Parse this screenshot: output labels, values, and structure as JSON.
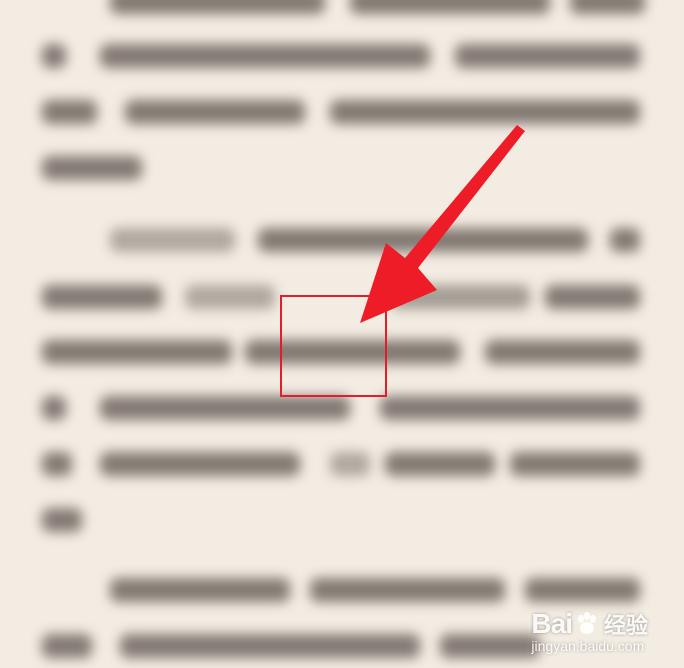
{
  "document": {
    "description_hidden": true
  },
  "annotation": {
    "box_color": "#e31d2b",
    "arrow_color": "#ee1c27"
  },
  "watermark": {
    "brand": "Bai",
    "brand_suffix": "经验",
    "domain": "jingyan.baidu.com"
  }
}
